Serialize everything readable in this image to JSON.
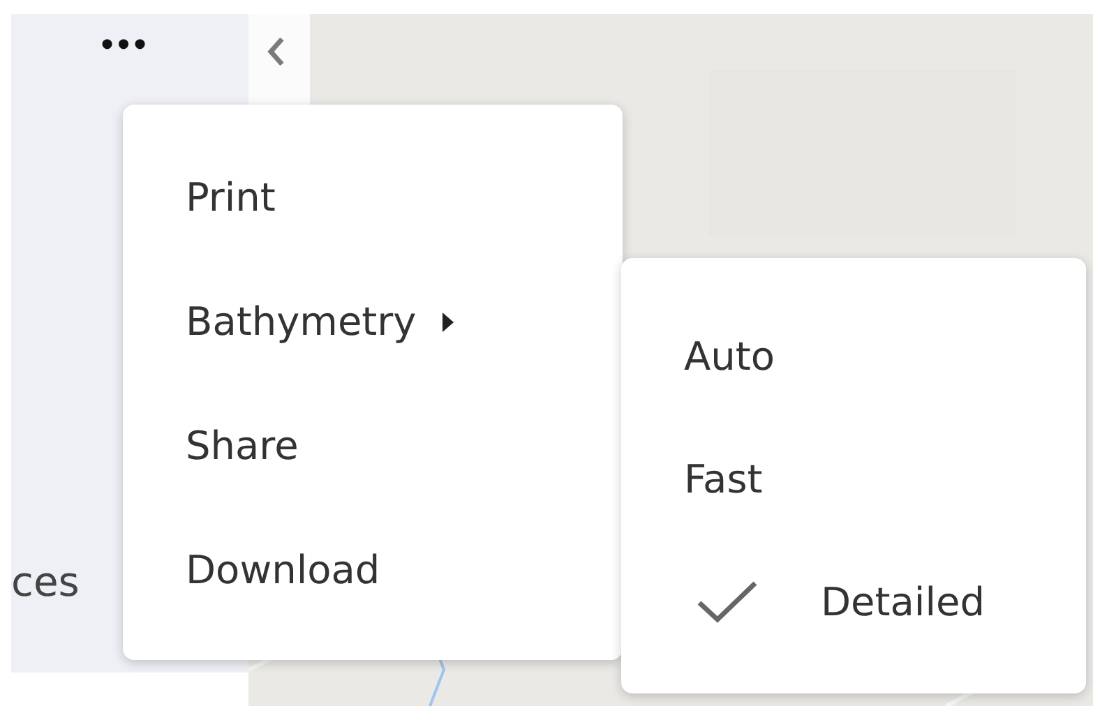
{
  "sidebar": {
    "more_button": "•••",
    "cut_label": "ces"
  },
  "menu": {
    "items": [
      {
        "label": "Print",
        "has_submenu": false
      },
      {
        "label": "Bathymetry",
        "has_submenu": true
      },
      {
        "label": "Share",
        "has_submenu": false
      },
      {
        "label": "Download",
        "has_submenu": false
      }
    ]
  },
  "submenu": {
    "items": [
      {
        "label": "Auto",
        "selected": false
      },
      {
        "label": "Fast",
        "selected": false
      },
      {
        "label": "Detailed",
        "selected": true
      }
    ]
  }
}
